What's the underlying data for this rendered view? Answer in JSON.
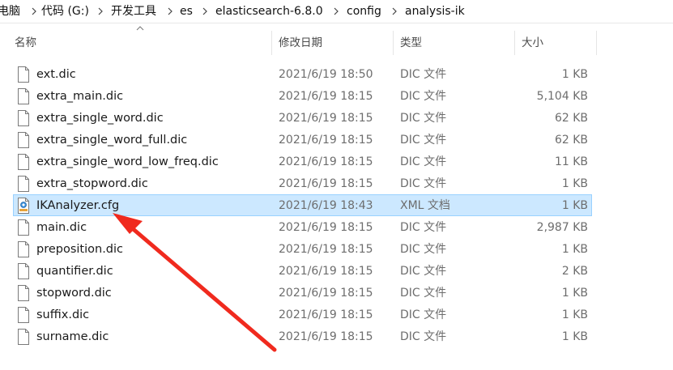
{
  "breadcrumb": {
    "items": [
      "电脑",
      "代码 (G:)",
      "开发工具",
      "es",
      "elasticsearch-6.8.0",
      "config",
      "analysis-ik"
    ]
  },
  "columns": {
    "name": "名称",
    "date": "修改日期",
    "type": "类型",
    "size": "大小"
  },
  "files": [
    {
      "name": "ext.dic",
      "date": "2021/6/19 18:50",
      "type": "DIC 文件",
      "size": "1 KB",
      "icon": "document-icon"
    },
    {
      "name": "extra_main.dic",
      "date": "2021/6/19 18:15",
      "type": "DIC 文件",
      "size": "5,104 KB",
      "icon": "document-icon"
    },
    {
      "name": "extra_single_word.dic",
      "date": "2021/6/19 18:15",
      "type": "DIC 文件",
      "size": "62 KB",
      "icon": "document-icon"
    },
    {
      "name": "extra_single_word_full.dic",
      "date": "2021/6/19 18:15",
      "type": "DIC 文件",
      "size": "62 KB",
      "icon": "document-icon"
    },
    {
      "name": "extra_single_word_low_freq.dic",
      "date": "2021/6/19 18:15",
      "type": "DIC 文件",
      "size": "11 KB",
      "icon": "document-icon"
    },
    {
      "name": "extra_stopword.dic",
      "date": "2021/6/19 18:15",
      "type": "DIC 文件",
      "size": "1 KB",
      "icon": "document-icon"
    },
    {
      "name": "IKAnalyzer.cfg",
      "date": "2021/6/19 18:43",
      "type": "XML 文档",
      "size": "1 KB",
      "icon": "xml-document-icon",
      "selected": true
    },
    {
      "name": "main.dic",
      "date": "2021/6/19 18:15",
      "type": "DIC 文件",
      "size": "2,987 KB",
      "icon": "document-icon"
    },
    {
      "name": "preposition.dic",
      "date": "2021/6/19 18:15",
      "type": "DIC 文件",
      "size": "1 KB",
      "icon": "document-icon"
    },
    {
      "name": "quantifier.dic",
      "date": "2021/6/19 18:15",
      "type": "DIC 文件",
      "size": "2 KB",
      "icon": "document-icon"
    },
    {
      "name": "stopword.dic",
      "date": "2021/6/19 18:15",
      "type": "DIC 文件",
      "size": "1 KB",
      "icon": "document-icon"
    },
    {
      "name": "suffix.dic",
      "date": "2021/6/19 18:15",
      "type": "DIC 文件",
      "size": "1 KB",
      "icon": "document-icon"
    },
    {
      "name": "surname.dic",
      "date": "2021/6/19 18:15",
      "type": "DIC 文件",
      "size": "1 KB",
      "icon": "document-icon"
    }
  ],
  "colors": {
    "selection_background": "#cce8ff",
    "selection_border": "#99d1ff",
    "annotation_arrow": "#f02a1e"
  }
}
